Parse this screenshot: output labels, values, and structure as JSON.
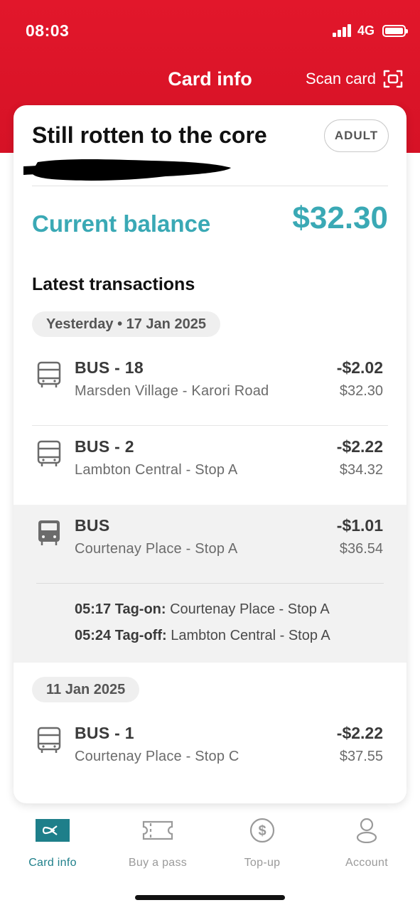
{
  "status_bar": {
    "time": "08:03",
    "network": "4G"
  },
  "header": {
    "title": "Card info",
    "scan_label": "Scan card"
  },
  "card": {
    "name": "Still rotten to the core",
    "type_badge": "ADULT",
    "balance_label": "Current balance",
    "balance_value": "$32.30",
    "transactions_title": "Latest transactions"
  },
  "groups": [
    {
      "date": "Yesterday • 17 Jan 2025",
      "transactions": [
        {
          "title": "BUS - 18",
          "subtitle": "Marsden Village - Karori Road",
          "amount": "-$2.02",
          "balance": "$32.30"
        },
        {
          "title": "BUS - 2",
          "subtitle": "Lambton Central - Stop A",
          "amount": "-$2.22",
          "balance": "$34.32"
        },
        {
          "title": "BUS",
          "subtitle": "Courtenay Place - Stop A",
          "amount": "-$1.01",
          "balance": "$36.54",
          "expanded": true,
          "details": [
            {
              "time_label": "05:17 Tag-on:",
              "place": "Courtenay Place - Stop A"
            },
            {
              "time_label": "05:24 Tag-off:",
              "place": "Lambton Central - Stop A"
            }
          ]
        }
      ]
    },
    {
      "date": "11 Jan 2025",
      "transactions": [
        {
          "title": "BUS - 1",
          "subtitle": "Courtenay Place - Stop C",
          "amount": "-$2.22",
          "balance": "$37.55"
        }
      ]
    }
  ],
  "tabs": [
    {
      "label": "Card info",
      "icon": "card-icon",
      "active": true
    },
    {
      "label": "Buy a pass",
      "icon": "ticket-icon",
      "active": false
    },
    {
      "label": "Top-up",
      "icon": "dollar-coin-icon",
      "active": false
    },
    {
      "label": "Account",
      "icon": "person-icon",
      "active": false
    }
  ],
  "colors": {
    "brand_red": "#e2172b",
    "accent_teal": "#3aa9b5",
    "active_tab": "#1e7f8a"
  }
}
